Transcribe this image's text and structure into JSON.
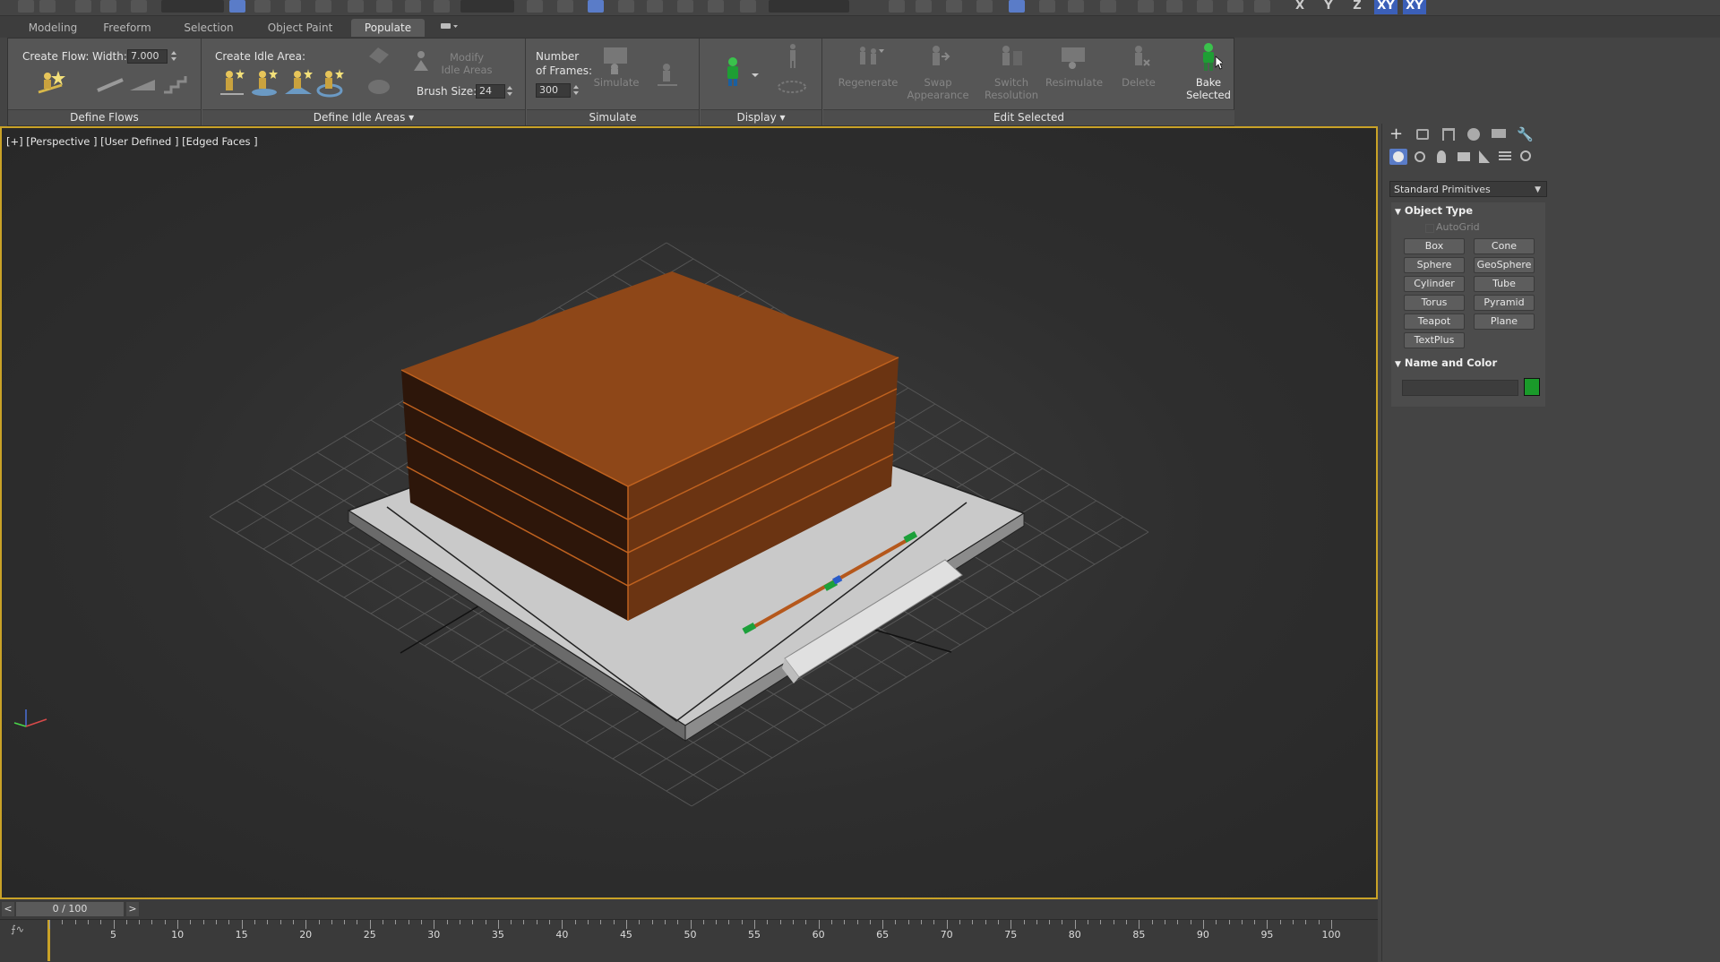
{
  "ribbon_tabs": [
    "Modeling",
    "Freeform",
    "Selection",
    "Object Paint",
    "Populate"
  ],
  "ribbon": {
    "define_flows": {
      "create_flow_label": "Create Flow:",
      "width_label": "Width:",
      "width_value": "7.000",
      "footer": "Define Flows"
    },
    "define_idle_areas": {
      "create_idle_area_label": "Create Idle Area:",
      "modify_idle_areas": "Modify\nIdle Areas",
      "brush_size_label": "Brush Size:",
      "brush_size_value": "24",
      "footer": "Define Idle Areas"
    },
    "simulate": {
      "number_of_frames_label": "Number\nof Frames:",
      "frames_value": "300",
      "simulate_button": "Simulate",
      "footer": "Simulate"
    },
    "display": {
      "footer": "Display"
    },
    "edit_selected": {
      "regenerate": "Regenerate",
      "swap_appearance": "Swap\nAppearance",
      "switch_resolution": "Switch\nResolution",
      "resimulate": "Resimulate",
      "delete": "Delete",
      "bake_selected": "Bake\nSelected",
      "footer": "Edit Selected"
    }
  },
  "toolbar_axes": [
    "X",
    "Y",
    "Z",
    "XY",
    "XY"
  ],
  "viewport": {
    "label": "[+] [Perspective ] [User Defined ] [Edged Faces ]",
    "border_color": "#c9a227"
  },
  "command_panel": {
    "category_dropdown": "Standard Primitives",
    "object_type": {
      "title": "Object Type",
      "autogrid": "AutoGrid",
      "buttons": [
        "Box",
        "Cone",
        "Sphere",
        "GeoSphere",
        "Cylinder",
        "Tube",
        "Torus",
        "Pyramid",
        "Teapot",
        "Plane",
        "TextPlus"
      ]
    },
    "name_and_color": {
      "title": "Name and Color",
      "name_value": "",
      "color": "#1a9a2a"
    }
  },
  "timeline": {
    "slider_text": "0 / 100",
    "prev": "<",
    "next": ">",
    "ticks": [
      "5",
      "10",
      "15",
      "20",
      "25",
      "30",
      "35",
      "40",
      "45",
      "50",
      "55",
      "60",
      "65",
      "70",
      "75",
      "80",
      "85",
      "90",
      "95",
      "100"
    ]
  },
  "colors": {
    "building_top": "#8e4718",
    "building_side": "#2d160a",
    "building_edge": "#c0621f",
    "flow_line": "#b5581c",
    "flow_marker": "#1ca03a"
  }
}
